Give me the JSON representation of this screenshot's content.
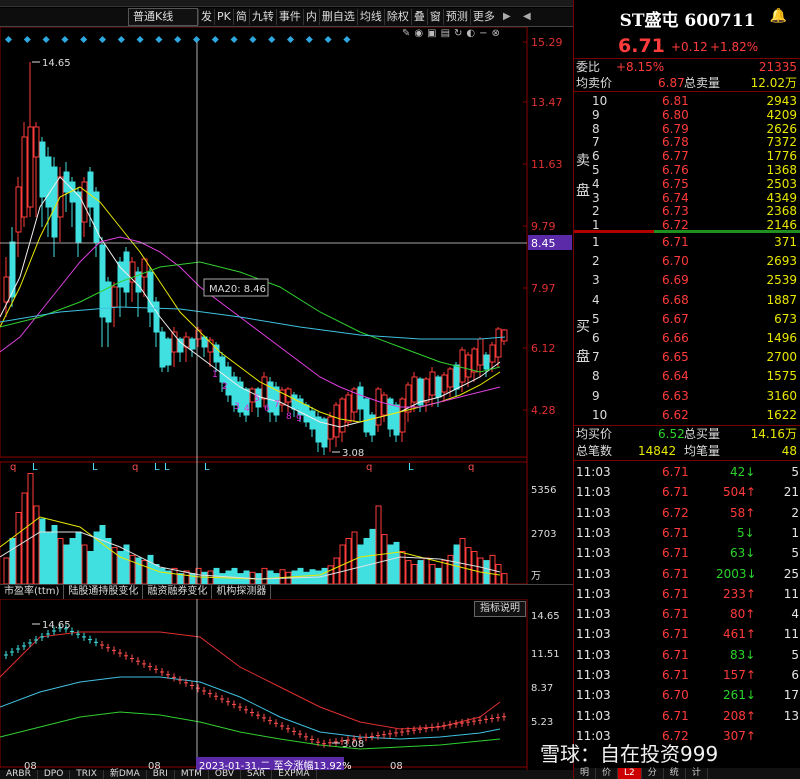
{
  "toolbar": {
    "kline_type": "普通K线",
    "buttons": [
      "发",
      "PK",
      "简",
      "九转",
      "事件",
      "内",
      "删自选",
      "均线",
      "除权",
      "叠",
      "窗",
      "预测",
      "更多"
    ]
  },
  "chart": {
    "price_scale": [
      "15.29",
      "13.47",
      "11.63",
      "9.79",
      "7.97",
      "6.12",
      "4.28"
    ],
    "crosshair_price": "8.45",
    "ma_tooltip": "MA20: 8.46",
    "high_label": "14.65",
    "low_label": "3.08",
    "volume_scale": [
      "5356",
      "2703",
      "万"
    ],
    "sub_scale": [
      "14.65",
      "11.51",
      "8.37",
      "5.23"
    ],
    "sub_high_label": "14.65",
    "sub_low_label": "3.08",
    "x_labels": [
      "08",
      "08",
      "08"
    ],
    "date_tooltip": "2023-01-31,二 至今涨幅13.92%",
    "signal_labels": [
      "q",
      "L",
      "L",
      "q",
      "L",
      "L",
      "L",
      "q",
      "L",
      "q"
    ],
    "purple_numbers": [
      "1",
      "2",
      "3",
      "4",
      "5",
      "6",
      "7",
      "8",
      "9"
    ]
  },
  "indicator_tabs": [
    "市盈率(ttm)",
    "陆股通持股变化",
    "融资融券变化",
    "机构探测器"
  ],
  "indicator_help": "指标说明",
  "bottom_tabs": [
    "ARBR",
    "DPO",
    "TRIX",
    "新DMA",
    "BRI",
    "MTM",
    "OBV",
    "SAR",
    "EXPMA"
  ],
  "quote": {
    "title": "ST盛屯 600711",
    "price": "6.71",
    "change": "+0.12",
    "change_pct": "+1.82%",
    "weibi_label": "委比",
    "weibi": "+8.15%",
    "weicha": "21335",
    "avg_sell_label": "均卖价",
    "avg_sell": "6.87",
    "total_sell_label": "总卖量",
    "total_sell": "12.02万",
    "sell_label": [
      "卖",
      "盘"
    ],
    "asks": [
      {
        "lvl": "10",
        "price": "6.81",
        "vol": "2943"
      },
      {
        "lvl": "9",
        "price": "6.80",
        "vol": "4209"
      },
      {
        "lvl": "8",
        "price": "6.79",
        "vol": "2626"
      },
      {
        "lvl": "7",
        "price": "6.78",
        "vol": "7372"
      },
      {
        "lvl": "6",
        "price": "6.77",
        "vol": "1776"
      },
      {
        "lvl": "5",
        "price": "6.76",
        "vol": "1368"
      },
      {
        "lvl": "4",
        "price": "6.75",
        "vol": "2503"
      },
      {
        "lvl": "3",
        "price": "6.74",
        "vol": "4349"
      },
      {
        "lvl": "2",
        "price": "6.73",
        "vol": "2368"
      },
      {
        "lvl": "1",
        "price": "6.72",
        "vol": "2146"
      }
    ],
    "buy_label": [
      "买",
      "盘"
    ],
    "bids": [
      {
        "lvl": "1",
        "price": "6.71",
        "vol": "371"
      },
      {
        "lvl": "2",
        "price": "6.70",
        "vol": "2693"
      },
      {
        "lvl": "3",
        "price": "6.69",
        "vol": "2539"
      },
      {
        "lvl": "4",
        "price": "6.68",
        "vol": "1887"
      },
      {
        "lvl": "5",
        "price": "6.67",
        "vol": "673"
      },
      {
        "lvl": "6",
        "price": "6.66",
        "vol": "1496"
      },
      {
        "lvl": "7",
        "price": "6.65",
        "vol": "2700"
      },
      {
        "lvl": "8",
        "price": "6.64",
        "vol": "1575"
      },
      {
        "lvl": "9",
        "price": "6.63",
        "vol": "3160"
      },
      {
        "lvl": "10",
        "price": "6.62",
        "vol": "1622"
      }
    ],
    "avg_buy_label": "均买价",
    "avg_buy": "6.52",
    "total_buy_label": "总买量",
    "total_buy": "14.16万",
    "total_trades_label": "总笔数",
    "total_trades": "14842",
    "avg_per_trade_label": "均笔量",
    "avg_per_trade": "48",
    "ticks": [
      {
        "time": "11:03",
        "price": "6.71",
        "vol": "42",
        "dir": "down",
        "cnt": "5"
      },
      {
        "time": "11:03",
        "price": "6.71",
        "vol": "504",
        "dir": "up",
        "cnt": "21"
      },
      {
        "time": "11:03",
        "price": "6.72",
        "vol": "58",
        "dir": "up",
        "cnt": "2"
      },
      {
        "time": "11:03",
        "price": "6.71",
        "vol": "5",
        "dir": "down",
        "cnt": "1"
      },
      {
        "time": "11:03",
        "price": "6.71",
        "vol": "63",
        "dir": "down",
        "cnt": "5"
      },
      {
        "time": "11:03",
        "price": "6.71",
        "vol": "2003",
        "dir": "down",
        "cnt": "25"
      },
      {
        "time": "11:03",
        "price": "6.71",
        "vol": "233",
        "dir": "up",
        "cnt": "11"
      },
      {
        "time": "11:03",
        "price": "6.71",
        "vol": "80",
        "dir": "up",
        "cnt": "4"
      },
      {
        "time": "11:03",
        "price": "6.71",
        "vol": "461",
        "dir": "up",
        "cnt": "11"
      },
      {
        "time": "11:03",
        "price": "6.71",
        "vol": "83",
        "dir": "down",
        "cnt": "5"
      },
      {
        "time": "11:03",
        "price": "6.71",
        "vol": "157",
        "dir": "up",
        "cnt": "6"
      },
      {
        "time": "11:03",
        "price": "6.70",
        "vol": "261",
        "dir": "down",
        "cnt": "17"
      },
      {
        "time": "11:03",
        "price": "6.71",
        "vol": "208",
        "dir": "up",
        "cnt": "13"
      },
      {
        "time": "11:03",
        "price": "6.72",
        "vol": "307",
        "dir": "up",
        "cnt": ""
      }
    ],
    "right_tabs": [
      "明",
      "价",
      "L2",
      "分",
      "统",
      "计"
    ]
  },
  "watermark": "雪球：自在投资999"
}
